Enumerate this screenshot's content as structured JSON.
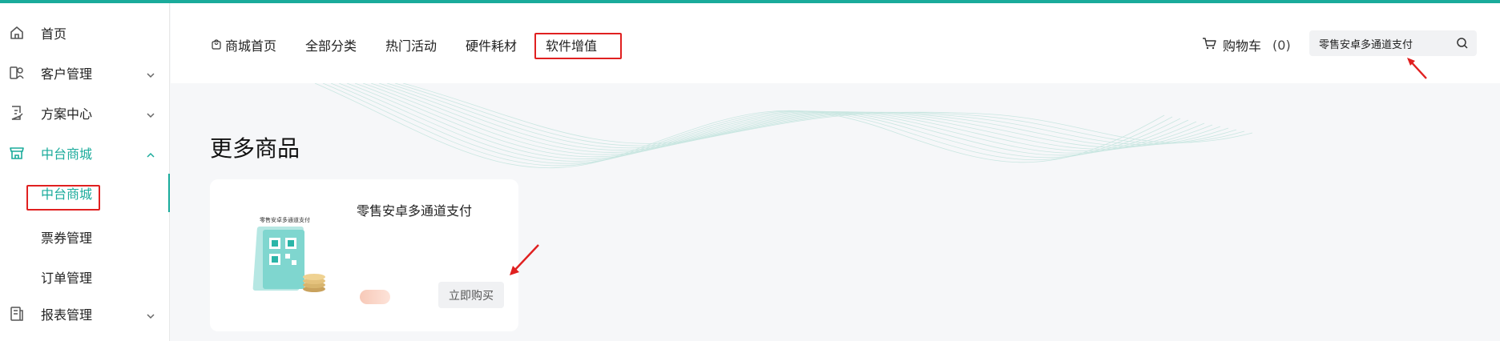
{
  "sidebar": {
    "items": [
      {
        "label": "首页",
        "icon": "home-icon"
      },
      {
        "label": "客户管理",
        "icon": "customer-icon"
      },
      {
        "label": "方案中心",
        "icon": "document-edit-icon"
      },
      {
        "label": "中台商城",
        "icon": "store-icon"
      },
      {
        "label": "报表管理",
        "icon": "report-icon"
      }
    ],
    "sub_items": [
      {
        "label": "中台商城"
      },
      {
        "label": "票券管理"
      },
      {
        "label": "订单管理"
      }
    ]
  },
  "header": {
    "tabs": [
      "商城首页",
      "全部分类",
      "热门活动",
      "硬件耗材",
      "软件增值"
    ],
    "cart_label": "购物车",
    "cart_count": "(0)",
    "search_value": "零售安卓多通道支付"
  },
  "main": {
    "section_title": "更多商品",
    "product": {
      "name": "零售安卓多通道支付",
      "thumb_caption": "零售安卓多通道支付",
      "buy_label": "立即购买"
    }
  },
  "colors": {
    "accent": "#1aab9b",
    "highlight_box": "#e02020"
  }
}
